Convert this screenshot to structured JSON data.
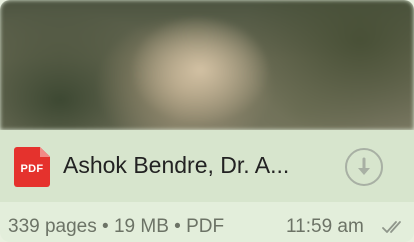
{
  "message": {
    "file": {
      "type_badge": "PDF",
      "name": "Ashok Bendre, Dr. A...",
      "icon": "pdf-file-icon",
      "action_icon": "download-icon"
    },
    "meta": {
      "pages": "339 pages",
      "separator": "•",
      "size": "19 MB",
      "format": "PDF",
      "time": "11:59 am",
      "status_icon": "double-check-icon"
    }
  },
  "colors": {
    "bubble_background": "#e3eedb",
    "file_row_background": "#d7e5cd",
    "pdf_red": "#e5322d",
    "meta_text": "#6c7366"
  }
}
